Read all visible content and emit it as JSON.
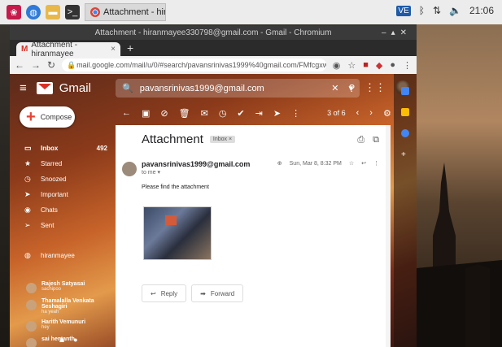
{
  "taskbar": {
    "window_label": "Attachment - hiranm...",
    "clock": "21:06",
    "vc_label": "VE"
  },
  "browser": {
    "window_title": "Attachment - hiranmayee330798@gmail.com - Gmail - Chromium",
    "tab_title": "Attachment - hiranmayee",
    "url": "mail.google.com/mail/u/0/#search/pavansrinivas1999%40gmail.com/FMfcgxwHMGJBbcMjzDKXXzqzCcG"
  },
  "gmail": {
    "app_name": "Gmail",
    "search_value": "pavansrinivas1999@gmail.com",
    "compose_label": "Compose",
    "pagination": "3 of 6",
    "nav": [
      {
        "label": "Inbox",
        "count": "492"
      },
      {
        "label": "Starred",
        "count": ""
      },
      {
        "label": "Snoozed",
        "count": ""
      },
      {
        "label": "Important",
        "count": ""
      },
      {
        "label": "Chats",
        "count": ""
      },
      {
        "label": "Sent",
        "count": ""
      }
    ],
    "account_chip": "hiranmayee",
    "contacts": [
      {
        "name": "Rajesh Satyasai",
        "sub": "sachipoo"
      },
      {
        "name": "Thamalalla Venkata Seshagiri",
        "sub": "ha yeah"
      },
      {
        "name": "Harith Vemunuri",
        "sub": "hey"
      },
      {
        "name": "sai hemanth",
        "sub": ""
      }
    ]
  },
  "message": {
    "subject": "Attachment",
    "label_chip": "Inbox ×",
    "sender": "pavansrinivas1999@gmail.com",
    "to": "to me ▾",
    "date": "Sun, Mar 8, 8:32 PM",
    "body": "Please find the attachment",
    "reply_label": "Reply",
    "forward_label": "Forward"
  }
}
